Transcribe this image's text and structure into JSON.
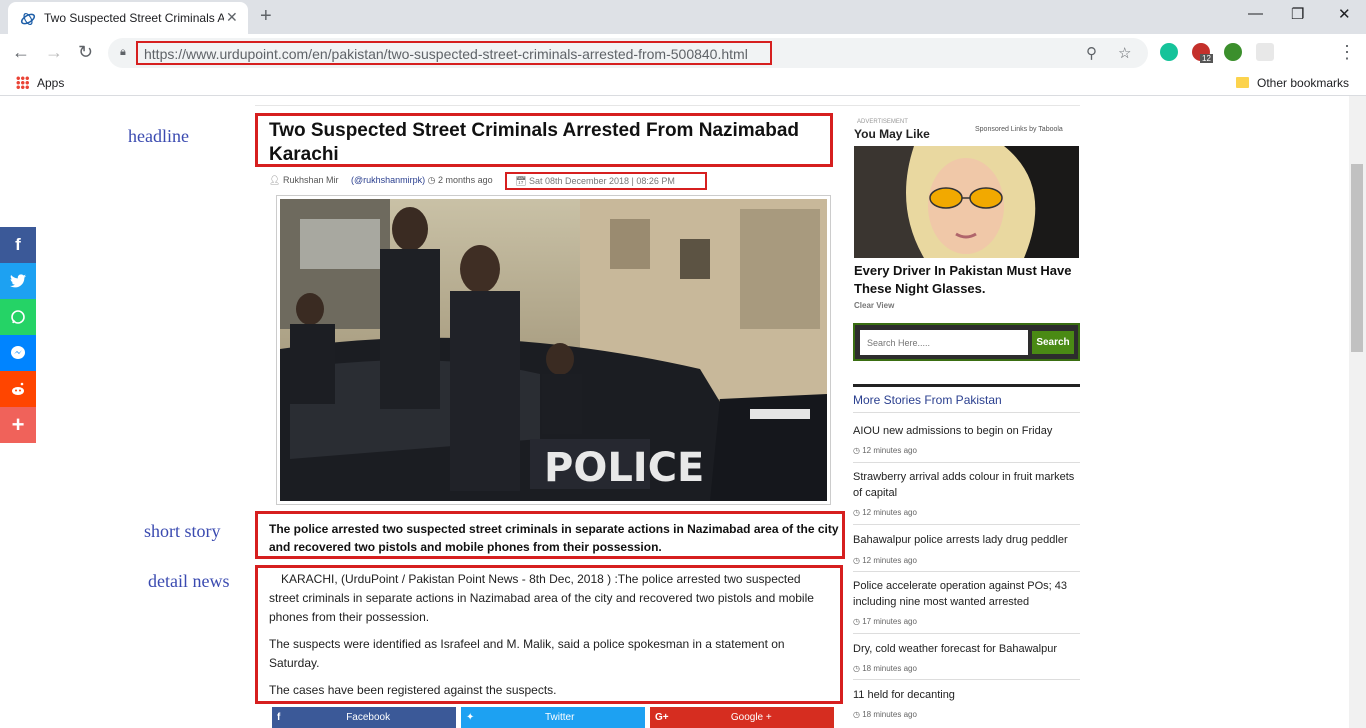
{
  "browser": {
    "tab_title": "Two Suspected Street Criminals A",
    "url": "https://www.urdupoint.com/en/pakistan/two-suspected-street-criminals-arrested-from-500840.html",
    "apps_label": "Apps",
    "other_bookmarks": "Other bookmarks",
    "ext_badge": "12"
  },
  "annotations": {
    "headline": "headline",
    "short_story": "short story",
    "detail_news": "detail news"
  },
  "article": {
    "headline": "Two Suspected Street Criminals Arrested From Nazimabad Karachi",
    "author": "Rukhshan Mir",
    "handle": "(@rukhshanmirpk)",
    "ago": "2 months ago",
    "date": "Sat 08th December 2018 | 08:26 PM",
    "image_text": "POLICE",
    "short_story": "The police arrested two suspected street criminals in separate actions in Nazimabad area of the city and recovered two pistols and mobile phones from their possession.",
    "detail": [
      "KARACHI, (UrduPoint / Pakistan Point News - 8th Dec, 2018 ) :The police arrested two suspected street criminals in separate actions in Nazimabad area of the city and recovered two pistols and mobile phones from their possession.",
      "The suspects were identified as Israfeel and M. Malik, said a police spokesman in a statement on Saturday.",
      "The cases have been registered against the suspects."
    ],
    "share": {
      "facebook": "Facebook",
      "twitter": "Twitter",
      "google": "Google +"
    }
  },
  "sidebar": {
    "ad_label": "ADVERTISEMENT",
    "you_may_like": "You May Like",
    "taboola": "Sponsored Links by Taboola",
    "ad_title": "Every Driver In Pakistan Must Have These Night Glasses.",
    "ad_source": "Clear View",
    "search_placeholder": "Search Here.....",
    "search_button": "Search",
    "more_title": "More Stories From Pakistan",
    "stories": [
      {
        "title": "AIOU new admissions to begin on Friday",
        "time": "12 minutes ago"
      },
      {
        "title": "Strawberry arrival adds colour in fruit markets of capital",
        "time": "12 minutes ago"
      },
      {
        "title": "Bahawalpur police arrests lady drug peddler",
        "time": "12 minutes ago"
      },
      {
        "title": "Police accelerate operation against POs; 43 including nine most wanted arrested",
        "time": "17 minutes ago"
      },
      {
        "title": "Dry, cold weather forecast for Bahawalpur",
        "time": "18 minutes ago"
      },
      {
        "title": "11 held for decanting",
        "time": "18 minutes ago"
      }
    ]
  },
  "colors": {
    "highlight": "#d61f1f",
    "annotation": "#3a4ab0",
    "facebook": "#3b5998",
    "twitter": "#1da1f2",
    "whatsapp": "#25d366",
    "messenger": "#0084ff",
    "reddit": "#ff4500",
    "more": "#f0625a",
    "google": "#d62d20",
    "search_green": "#4a8a14"
  },
  "icons": {
    "tab": "urdupoint-logo-icon",
    "share_left": [
      "facebook-icon",
      "twitter-icon",
      "whatsapp-icon",
      "messenger-icon",
      "reddit-icon",
      "plus-icon"
    ]
  }
}
